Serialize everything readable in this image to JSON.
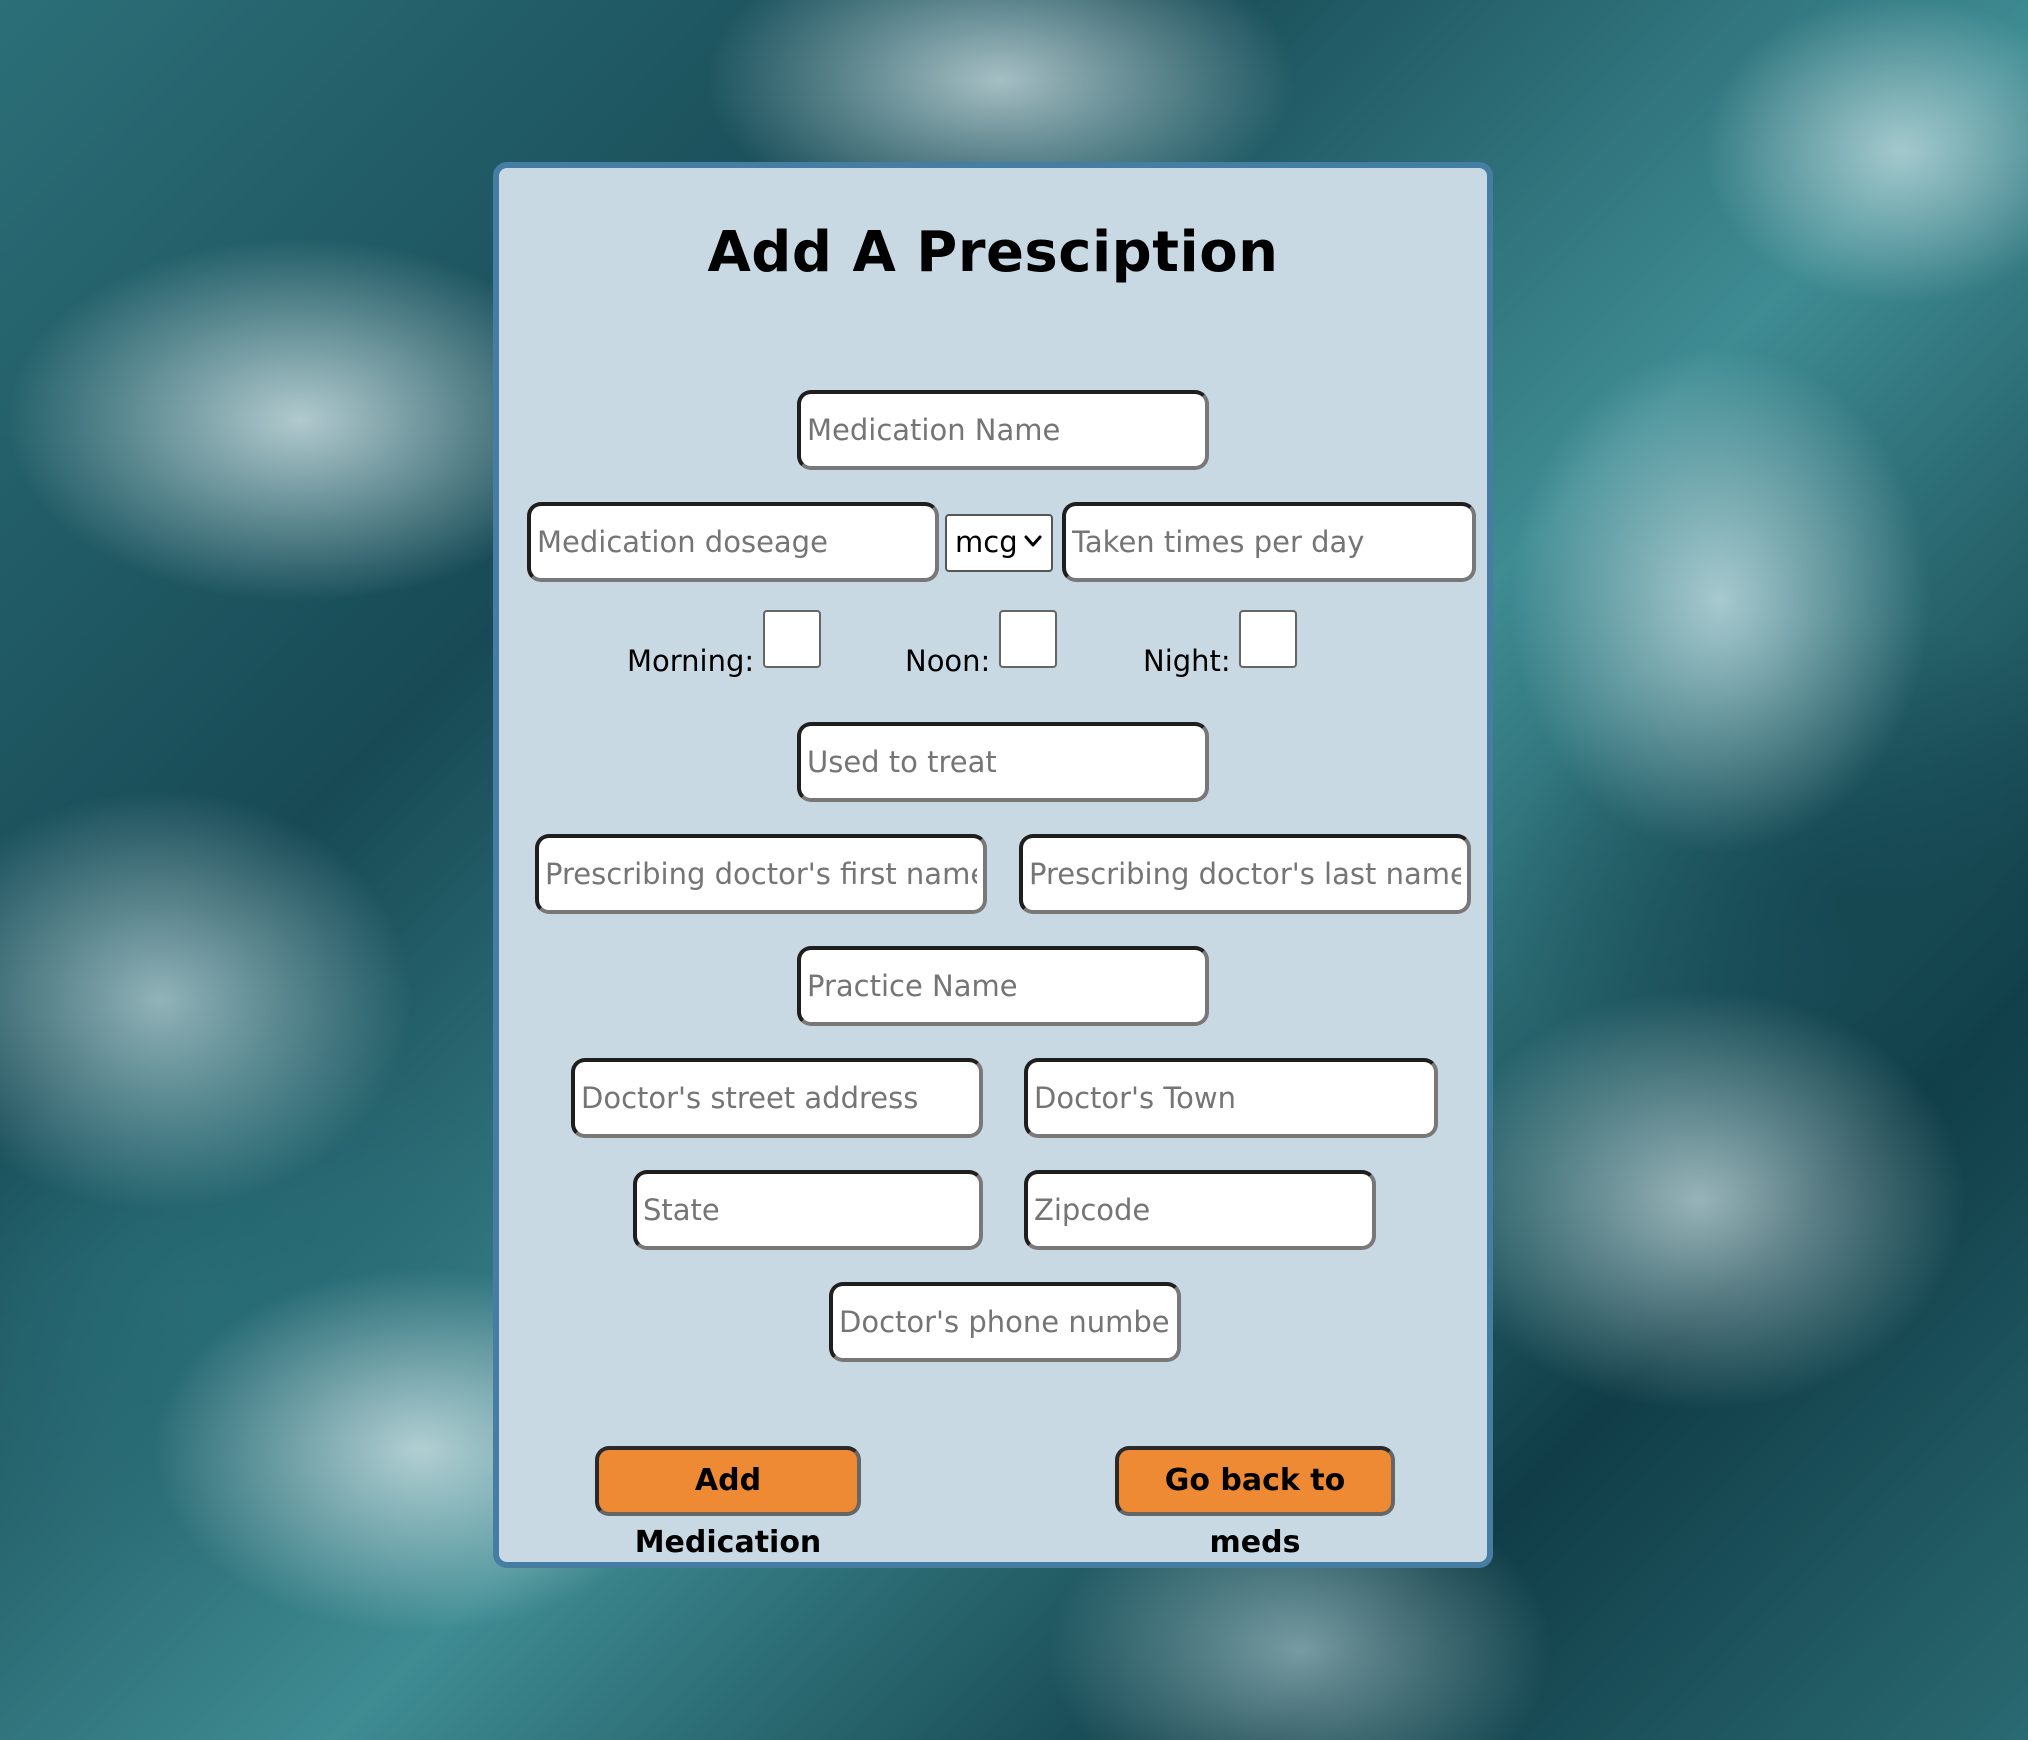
{
  "form": {
    "title": "Add A Presciption",
    "medication_name": {
      "placeholder": "Medication Name",
      "value": ""
    },
    "dosage": {
      "placeholder": "Medication doseage",
      "value": ""
    },
    "unit_select": {
      "selected": "mcg"
    },
    "times_per_day": {
      "placeholder": "Taken times per day",
      "value": ""
    },
    "time_of_day": {
      "morning_label": "Morning:",
      "noon_label": "Noon:",
      "night_label": "Night:",
      "morning_checked": false,
      "noon_checked": false,
      "night_checked": false
    },
    "used_to_treat": {
      "placeholder": "Used to treat",
      "value": ""
    },
    "doctor_first_name": {
      "placeholder": "Prescribing doctor's first name",
      "value": ""
    },
    "doctor_last_name": {
      "placeholder": "Prescribing doctor's last name",
      "value": ""
    },
    "practice_name": {
      "placeholder": "Practice Name",
      "value": ""
    },
    "doctor_street": {
      "placeholder": "Doctor's street address",
      "value": ""
    },
    "doctor_town": {
      "placeholder": "Doctor's Town",
      "value": ""
    },
    "state": {
      "placeholder": "State",
      "value": ""
    },
    "zipcode": {
      "placeholder": "Zipcode",
      "value": ""
    },
    "doctor_phone": {
      "placeholder": "Doctor's phone number",
      "value": ""
    },
    "add_button_label": "Add Medication",
    "back_button_label": "Go back to meds"
  },
  "colors": {
    "card_background": "#c9d9e3",
    "card_border": "#467ea3",
    "button_background": "#ee8a33"
  },
  "icons": {
    "select_arrow": "chevron-down-icon"
  }
}
